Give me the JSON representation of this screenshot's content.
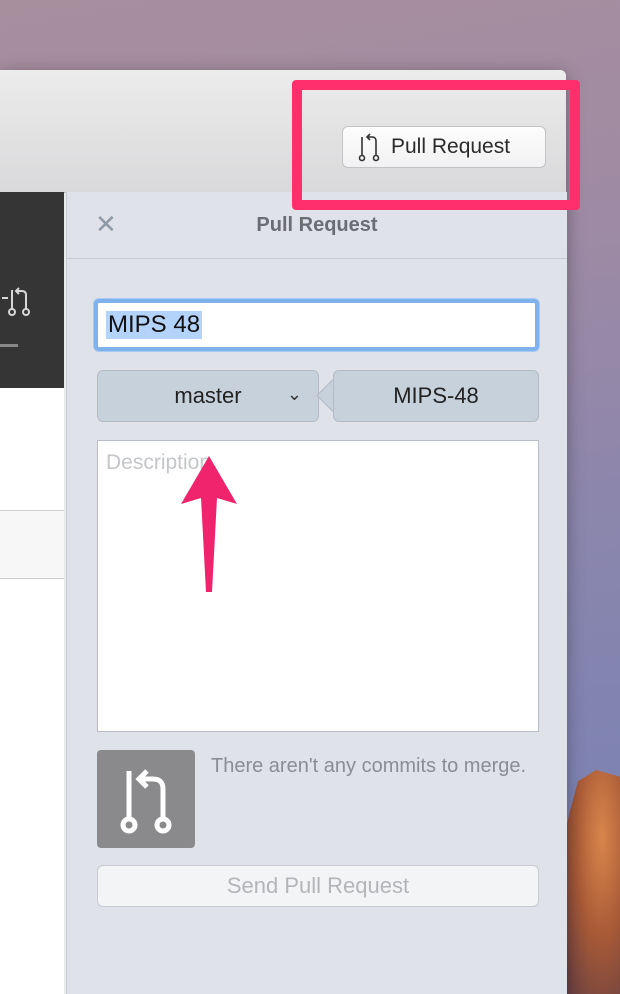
{
  "toolbar": {
    "pull_request_label": "Pull Request",
    "icon": "pull-request-icon"
  },
  "panel": {
    "title": "Pull Request",
    "close_icon": "close-icon",
    "title_field_value": "MIPS 48",
    "base_branch": "master",
    "head_branch": "MIPS-48",
    "description_placeholder": "Description",
    "status_message": "There aren't any commits to merge.",
    "send_button_label": "Send Pull Request"
  },
  "annotation": {
    "highlight_color": "#ff2f6b",
    "arrow_color": "#f0246c"
  }
}
